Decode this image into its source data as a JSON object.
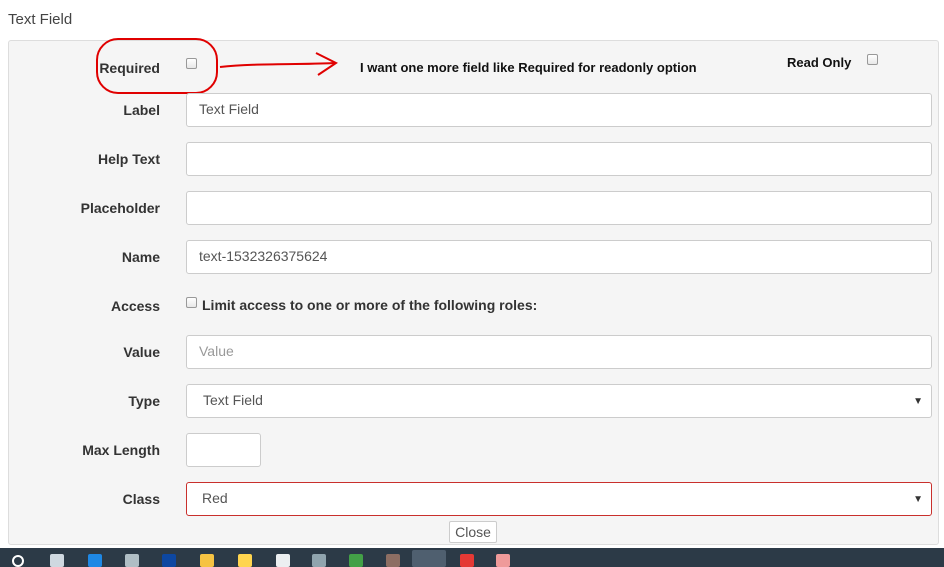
{
  "dialog": {
    "title": "Text Field"
  },
  "annotation": {
    "note": "I want one more field like Required for readonly option",
    "readonly_label": "Read Only"
  },
  "form": {
    "required_label": "Required",
    "label_label": "Label",
    "label_value": "Text Field",
    "help_label": "Help Text",
    "help_value": "",
    "placeholder_label": "Placeholder",
    "placeholder_value": "",
    "name_label": "Name",
    "name_value": "text-1532326375624",
    "access_label": "Access",
    "access_text": "Limit access to one or more of the following roles:",
    "value_label": "Value",
    "value_placeholder": "Value",
    "type_label": "Type",
    "type_value": "Text Field",
    "maxlength_label": "Max Length",
    "maxlength_value": "",
    "class_label": "Class",
    "class_value": "Red",
    "close_label": "Close"
  },
  "colors": {
    "annotation": "#e00000",
    "taskbar": "#2c3a47",
    "class_border": "#c9302c"
  }
}
